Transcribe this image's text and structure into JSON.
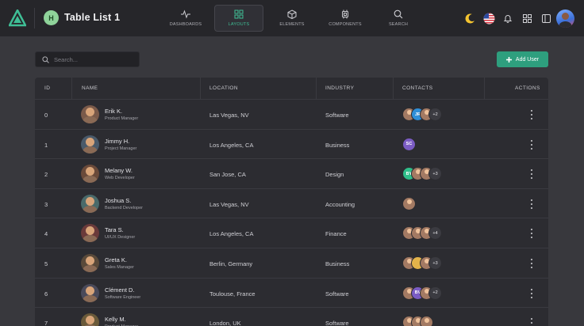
{
  "header": {
    "workspace_initial": "H",
    "title": "Table List 1",
    "nav": [
      {
        "label": "DASHBOARDS",
        "icon": "activity-icon"
      },
      {
        "label": "LAYOUTS",
        "icon": "grid-icon"
      },
      {
        "label": "ELEMENTS",
        "icon": "box-icon"
      },
      {
        "label": "COMPONENTS",
        "icon": "cpu-icon"
      },
      {
        "label": "SEARCH",
        "icon": "search-icon"
      }
    ],
    "active_nav": "LAYOUTS"
  },
  "toolbar": {
    "search_placeholder": "Search...",
    "add_label": "Add User"
  },
  "table": {
    "columns": [
      "ID",
      "NAME",
      "LOCATION",
      "INDUSTRY",
      "CONTACTS",
      "ACTIONS"
    ],
    "rows": [
      {
        "id": "0",
        "name": "Erik K.",
        "role": "Product Manager",
        "location": "Las Vegas, NV",
        "industry": "Software",
        "contacts": [
          {
            "type": "photo"
          },
          {
            "type": "initials",
            "text": "JR",
            "color": "#2f8fd8"
          },
          {
            "type": "photo"
          }
        ],
        "more": "+2"
      },
      {
        "id": "1",
        "name": "Jimmy H.",
        "role": "Project Manager",
        "location": "Los Angeles, CA",
        "industry": "Business",
        "contacts": [
          {
            "type": "initials",
            "text": "SC",
            "color": "#7b5cc4"
          }
        ],
        "more": ""
      },
      {
        "id": "2",
        "name": "Melany W.",
        "role": "Web Developer",
        "location": "San Jose, CA",
        "industry": "Design",
        "contacts": [
          {
            "type": "initials",
            "text": "BY",
            "color": "#2fbf8a"
          },
          {
            "type": "photo"
          },
          {
            "type": "photo"
          }
        ],
        "more": "+3"
      },
      {
        "id": "3",
        "name": "Joshua S.",
        "role": "Backend Developer",
        "location": "Las Vegas, NV",
        "industry": "Accounting",
        "contacts": [
          {
            "type": "photo"
          }
        ],
        "more": ""
      },
      {
        "id": "4",
        "name": "Tara S.",
        "role": "UI/UX Designer",
        "location": "Los Angeles, CA",
        "industry": "Finance",
        "contacts": [
          {
            "type": "photo"
          },
          {
            "type": "photo"
          },
          {
            "type": "photo"
          }
        ],
        "more": "+4"
      },
      {
        "id": "5",
        "name": "Greta K.",
        "role": "Sales Manager",
        "location": "Berlin, Germany",
        "industry": "Business",
        "contacts": [
          {
            "type": "photo"
          },
          {
            "type": "initials",
            "text": "",
            "color": "#e3b34a"
          },
          {
            "type": "photo"
          }
        ],
        "more": "+3"
      },
      {
        "id": "6",
        "name": "Clément D.",
        "role": "Software Engineer",
        "location": "Toulouse, France",
        "industry": "Software",
        "contacts": [
          {
            "type": "photo"
          },
          {
            "type": "initials",
            "text": "BV",
            "color": "#7b5cc4"
          },
          {
            "type": "photo"
          }
        ],
        "more": "+2"
      },
      {
        "id": "7",
        "name": "Kelly M.",
        "role": "Product Manager",
        "location": "London, UK",
        "industry": "Software",
        "contacts": [
          {
            "type": "photo"
          },
          {
            "type": "photo"
          },
          {
            "type": "photo"
          }
        ],
        "more": ""
      }
    ]
  }
}
